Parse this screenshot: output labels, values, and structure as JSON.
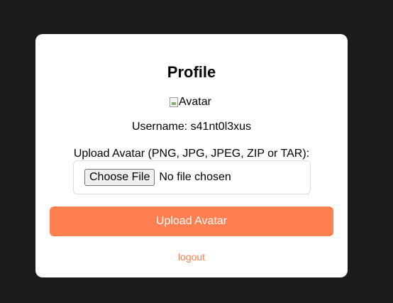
{
  "page": {
    "background": "#1b1b1b",
    "accent": "#ff7f50"
  },
  "profile": {
    "title": "Profile",
    "avatar_alt": "Avatar",
    "username_text": "Username: s41nt0l3xus"
  },
  "upload": {
    "label": "Upload Avatar (PNG, JPG, JPEG, ZIP or TAR):",
    "choose_button": "Choose File",
    "file_status": "No file chosen",
    "submit_label": "Upload Avatar"
  },
  "nav": {
    "logout_label": "logout"
  }
}
